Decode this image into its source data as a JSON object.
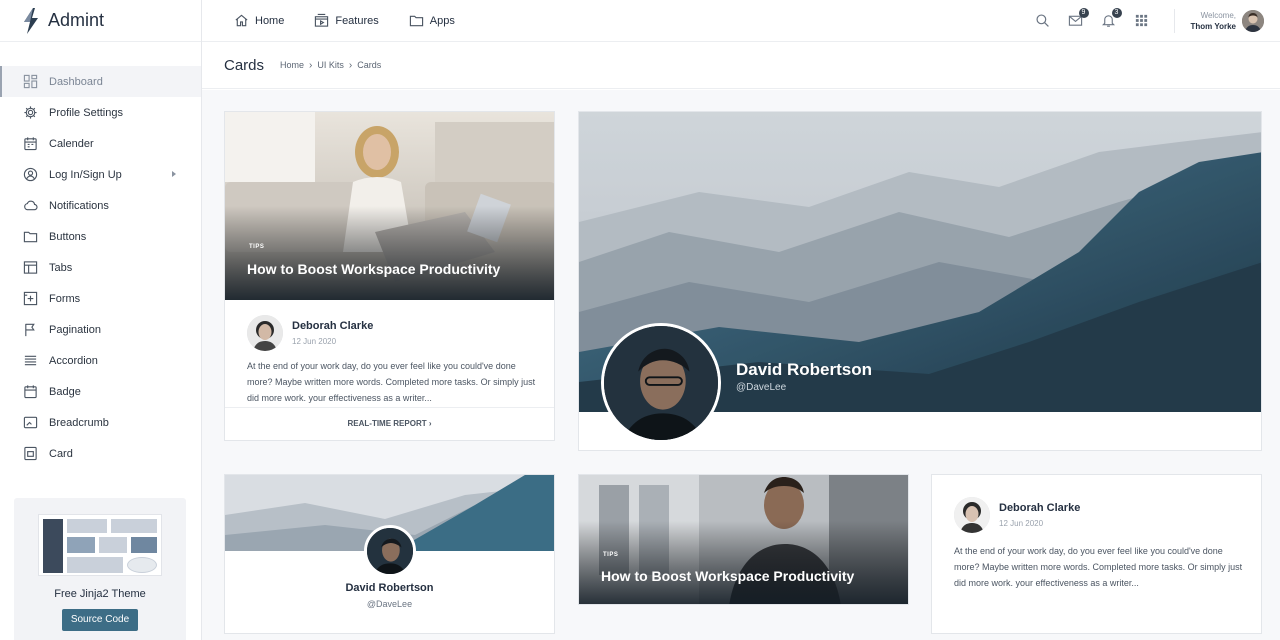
{
  "brand": {
    "name": "Admint"
  },
  "sidebar": {
    "items": [
      {
        "label": "Dashboard",
        "icon": "dashboard-icon",
        "active": true
      },
      {
        "label": "Profile Settings",
        "icon": "gear-icon"
      },
      {
        "label": "Calender",
        "icon": "calendar-icon"
      },
      {
        "label": "Log In/Sign Up",
        "icon": "user-circle-icon",
        "has_submenu": true
      },
      {
        "label": "Notifications",
        "icon": "cloud-icon"
      },
      {
        "label": "Buttons",
        "icon": "folder-icon"
      },
      {
        "label": "Tabs",
        "icon": "table-icon"
      },
      {
        "label": "Forms",
        "icon": "plus-square-icon"
      },
      {
        "label": "Pagination",
        "icon": "flag-icon"
      },
      {
        "label": "Accordion",
        "icon": "list-icon"
      },
      {
        "label": "Badge",
        "icon": "calendar-icon"
      },
      {
        "label": "Breadcrumb",
        "icon": "window-icon"
      },
      {
        "label": "Card",
        "icon": "card-icon"
      }
    ],
    "promo": {
      "title": "Free Jinja2 Theme",
      "button": "Source Code"
    }
  },
  "topbar": {
    "nav": [
      {
        "label": "Home",
        "icon": "home-icon"
      },
      {
        "label": "Features",
        "icon": "video-icon"
      },
      {
        "label": "Apps",
        "icon": "folder-icon"
      }
    ],
    "mail_count": "9",
    "notif_count": "3",
    "welcome": "Welcome,",
    "user_name": "Thom Yorke"
  },
  "page": {
    "title": "Cards",
    "breadcrumb": [
      "Home",
      "UI Kits",
      "Cards"
    ]
  },
  "cards": {
    "blog": {
      "tag": "TIPS",
      "title": "How to Boost Workspace Productivity",
      "author": "Deborah Clarke",
      "date": "12 Jun 2020",
      "excerpt": "At the end of your work day, do you ever feel like you could've done more? Maybe written more words. Completed more tasks. Or simply just did more work. your effectiveness as a writer...",
      "footer": "REAL-TIME REPORT ›"
    },
    "profile_large": {
      "name": "David Robertson",
      "handle": "@DaveLee"
    },
    "profile_small": {
      "name": "David Robertson",
      "handle": "@DaveLee"
    },
    "blog_small": {
      "tag": "TIPS",
      "title": "How to Boost Workspace Productivity"
    },
    "author_card": {
      "author": "Deborah Clarke",
      "date": "12 Jun 2020",
      "excerpt": "At the end of your work day, do you ever feel like you could've done more? Maybe written more words. Completed more tasks. Or simply just did more work. your effectiveness as a writer..."
    }
  },
  "colors": {
    "accent": "#3d6d86",
    "mountain_dark": "#1f3340",
    "mountain_teal": "#3b6d85"
  }
}
